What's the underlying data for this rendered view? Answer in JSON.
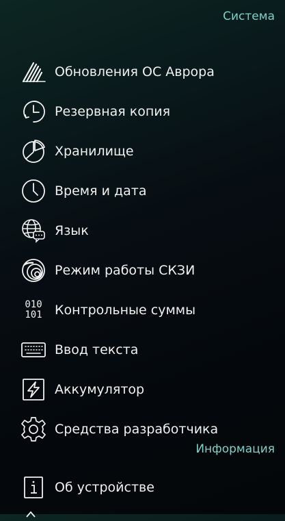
{
  "sections": {
    "system": "Система",
    "info": "Информация"
  },
  "items": [
    {
      "label": "Обновления ОС Аврора",
      "icon": "aurora-updates-icon"
    },
    {
      "label": "Резервная копия",
      "icon": "backup-clock-icon"
    },
    {
      "label": "Хранилище",
      "icon": "storage-pie-icon"
    },
    {
      "label": "Время и дата",
      "icon": "clock-icon"
    },
    {
      "label": "Язык",
      "icon": "globe-chat-icon"
    },
    {
      "label": "Режим работы СКЗИ",
      "icon": "crypto-swirl-icon"
    },
    {
      "label": "Контрольные суммы",
      "icon": "binary-checksum-icon"
    },
    {
      "label": "Ввод текста",
      "icon": "keyboard-icon"
    },
    {
      "label": "Аккумулятор",
      "icon": "battery-bolt-icon"
    },
    {
      "label": "Средства разработчика",
      "icon": "gear-icon"
    }
  ],
  "info_items": [
    {
      "label": "Об устройстве",
      "icon": "info-icon"
    }
  ],
  "binary_icon_text": {
    "line1": "010",
    "line2": "101"
  },
  "colors": {
    "section_header": "#7fd1c6",
    "text": "#f0f0f0",
    "background": "#05090d"
  }
}
